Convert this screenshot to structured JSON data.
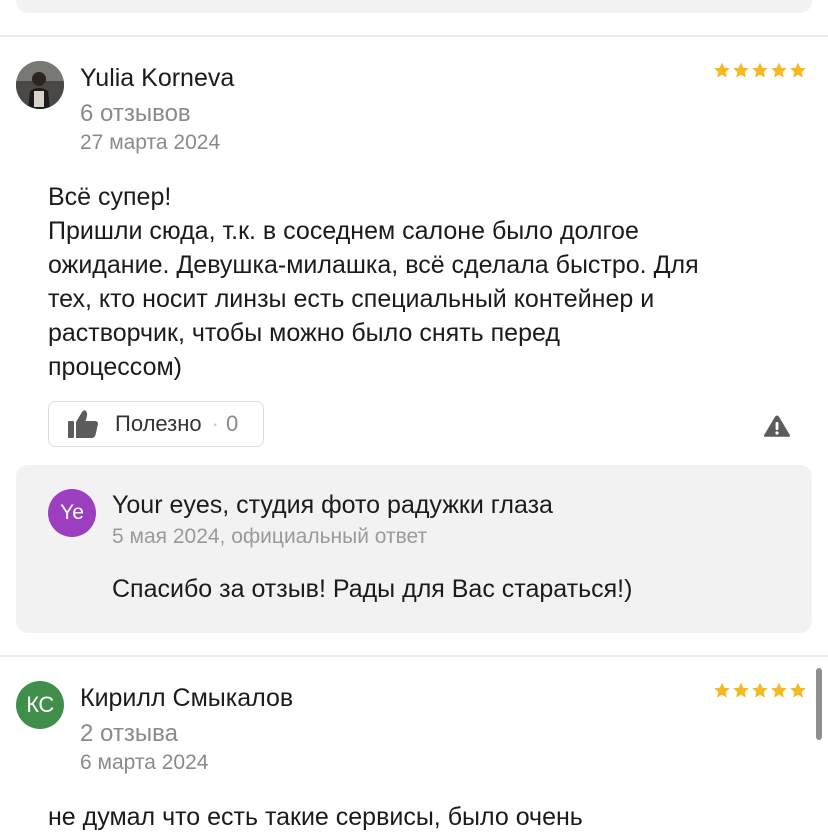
{
  "reviews": [
    {
      "author": "Yulia Korneva",
      "review_count": "6 отзывов",
      "date": "27 марта 2024",
      "rating": 5,
      "text_lines": [
        "Всё супер!",
        "Пришли сюда, т.к. в соседнем салоне было долгое",
        "ожидание. Девушка-милашка, всё сделала быстро. Для",
        "тех, кто носит линзы есть специальный контейнер и",
        "растворчик, чтобы можно было снять перед",
        "процессом)"
      ],
      "helpful": {
        "label": "Полезно",
        "separator": "·",
        "count": "0"
      },
      "reply": {
        "initials": "Ye",
        "org": "Your eyes, студия фото радужки глаза",
        "meta": "5 мая 2024, официальный ответ",
        "text": "Спасибо за отзыв! Рады для Вас стараться!)"
      }
    },
    {
      "author": "Кирилл Смыкалов",
      "initials": "КС",
      "review_count": "2 отзыва",
      "date": "6 марта 2024",
      "rating": 5,
      "text_partial": "не думал что есть такие сервисы, было очень"
    }
  ],
  "colors": {
    "star": "#f5b921",
    "avatar_kc": "#3f8f4a",
    "avatar_ye": "#9b3fc0",
    "icon_gray": "#5c5c5c"
  },
  "icons": {
    "helpful": "thumbs-up-icon",
    "report": "warning-icon"
  }
}
